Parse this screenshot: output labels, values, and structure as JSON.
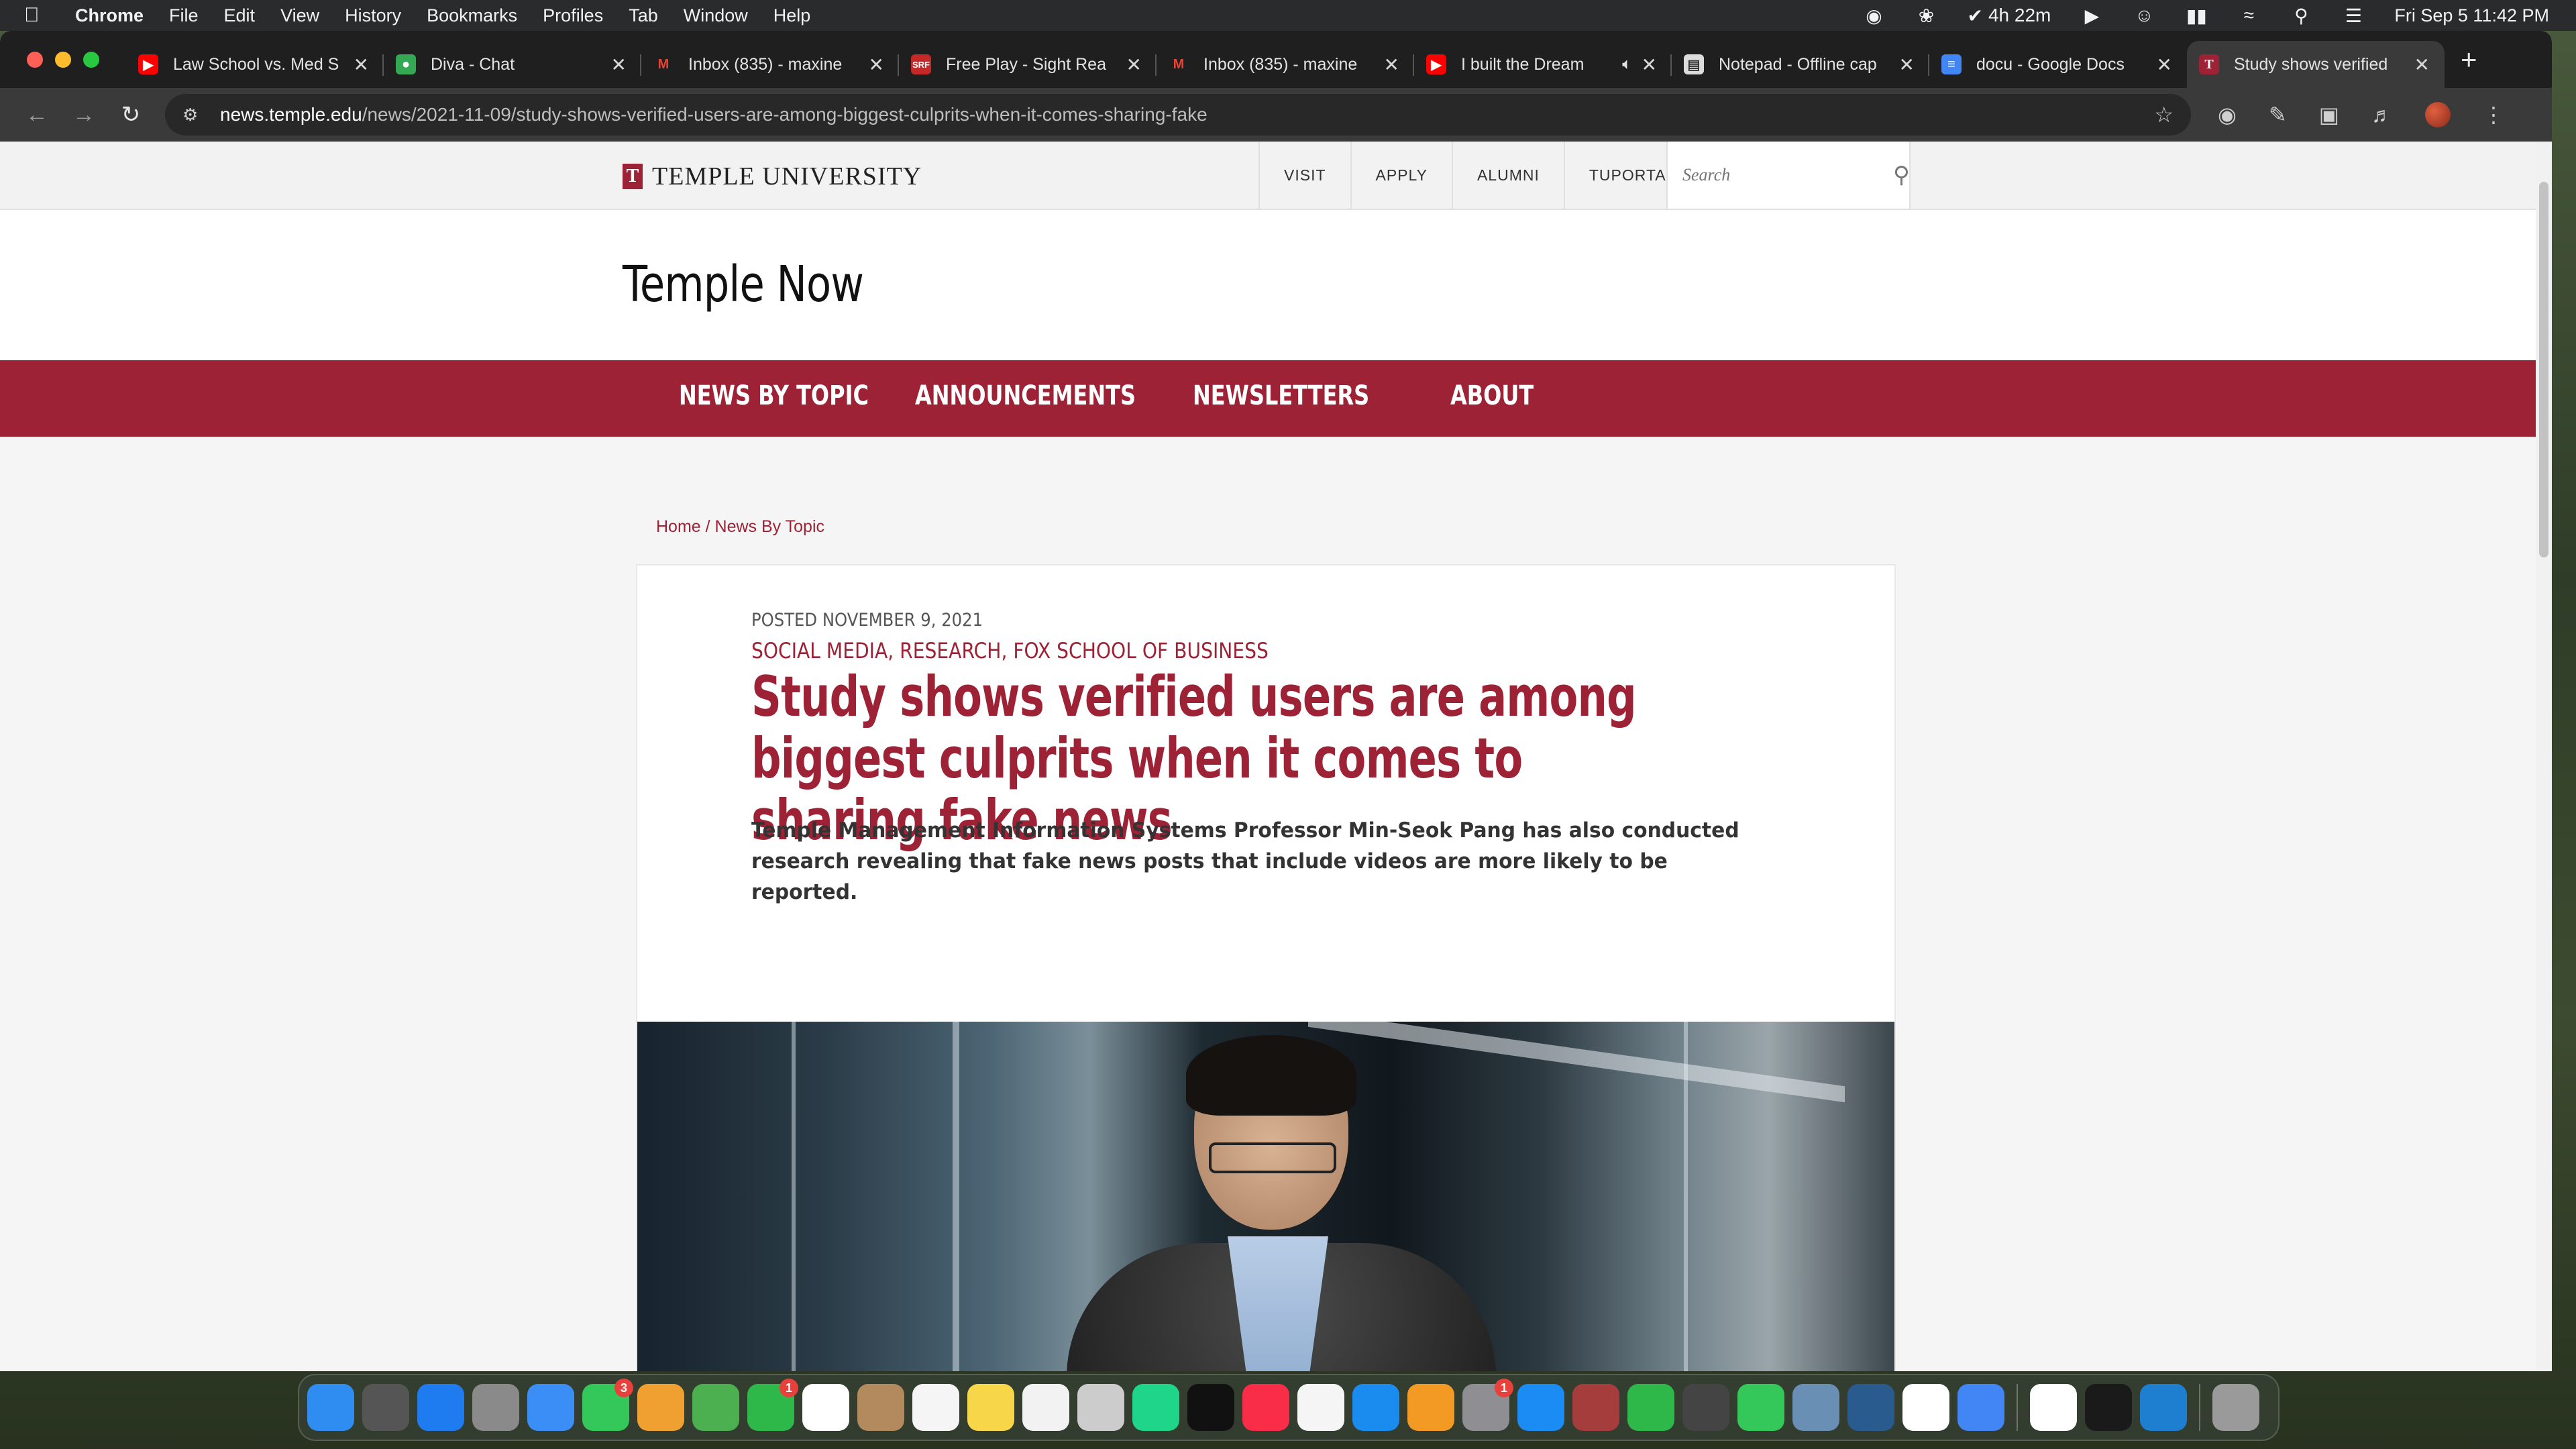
{
  "menubar": {
    "app": "Chrome",
    "items": [
      "File",
      "Edit",
      "View",
      "History",
      "Bookmarks",
      "Profiles",
      "Tab",
      "Window",
      "Help"
    ],
    "timer": "4h 22m",
    "datetime": "Fri Sep 5  11:42 PM"
  },
  "tabs": [
    {
      "title": "Law School vs. Med S",
      "icon": "youtube-icon",
      "color": "#ff0000"
    },
    {
      "title": "Diva - Chat",
      "icon": "google-chat-icon",
      "color": "#34a853"
    },
    {
      "title": "Inbox (835) - maxine",
      "icon": "gmail-icon",
      "color": "#ea4335"
    },
    {
      "title": "Free Play - Sight Rea",
      "icon": "sightreading-icon",
      "color": "#c62828"
    },
    {
      "title": "Inbox (835) - maxine",
      "icon": "gmail-icon",
      "color": "#ea4335"
    },
    {
      "title": "I built the Dream",
      "icon": "youtube-icon",
      "color": "#ff0000"
    },
    {
      "title": "Notepad - Offline cap",
      "icon": "notepad-icon",
      "color": "#dddddd"
    },
    {
      "title": "docu - Google Docs",
      "icon": "google-docs-icon",
      "color": "#4285f4"
    },
    {
      "title": "Study shows verified",
      "icon": "temple-icon",
      "color": "#9d2235"
    }
  ],
  "address": {
    "url_host": "news.temple.edu",
    "url_path": "/news/2021-11-09/study-shows-verified-users-are-among-biggest-culprits-when-it-comes-sharing-fake"
  },
  "site": {
    "university": "TEMPLE UNIVERSITY",
    "util_nav": [
      "VISIT",
      "APPLY",
      "ALUMNI",
      "TUPORTAL"
    ],
    "search_placeholder": "Search",
    "title": "Temple Now",
    "main_nav": [
      "NEWS BY TOPIC",
      "ANNOUNCEMENTS",
      "NEWSLETTERS",
      "ABOUT"
    ],
    "breadcrumb": {
      "home": "Home",
      "separator": " / ",
      "current": "News By Topic"
    },
    "accent_color": "#9d2235"
  },
  "article": {
    "posted": "POSTED NOVEMBER 9, 2021",
    "categories": [
      "SOCIAL MEDIA",
      "RESEARCH",
      "FOX SCHOOL OF BUSINESS"
    ],
    "headline": "Study shows verified users are among biggest culprits when it comes to sharing fake news",
    "dek": "Temple Management Information Systems Professor Min-Seok Pang has also conducted research revealing that fake news posts that include videos are more likely to be reported."
  },
  "dock": {
    "apps": [
      {
        "name": "finder-icon",
        "color": "#2f8cf0"
      },
      {
        "name": "launchpad-rocket-icon",
        "color": "#555555"
      },
      {
        "name": "safari-icon",
        "color": "#1e7bf0"
      },
      {
        "name": "launchpad-icon",
        "color": "#8a8a8a"
      },
      {
        "name": "mail-icon",
        "color": "#3a8ef5"
      },
      {
        "name": "messages-icon",
        "color": "#34c759",
        "badge": "3"
      },
      {
        "name": "photos-icon",
        "color": "#f0a030"
      },
      {
        "name": "maps-icon",
        "color": "#4caf50"
      },
      {
        "name": "facetime-icon",
        "color": "#2fb84a",
        "badge": "1"
      },
      {
        "name": "calendar-icon",
        "color": "#ffffff"
      },
      {
        "name": "contacts-icon",
        "color": "#b38a5e"
      },
      {
        "name": "reminders-icon",
        "color": "#f5f5f5"
      },
      {
        "name": "notes-icon",
        "color": "#f7d64a"
      },
      {
        "name": "freeform-icon",
        "color": "#f2f2f2"
      },
      {
        "name": "script-editor-icon",
        "color": "#cccccc"
      },
      {
        "name": "pycharm-icon",
        "color": "#1ed58a"
      },
      {
        "name": "apple-tv-icon",
        "color": "#111111"
      },
      {
        "name": "music-icon",
        "color": "#fa2d48"
      },
      {
        "name": "news-icon",
        "color": "#f5f5f5"
      },
      {
        "name": "keynote-icon",
        "color": "#1a8cf0"
      },
      {
        "name": "pages-icon",
        "color": "#f39a24"
      },
      {
        "name": "system-settings-icon",
        "color": "#8e8e93",
        "badge": "1"
      },
      {
        "name": "app-store-icon",
        "color": "#1c8cf5"
      },
      {
        "name": "dictionary-icon",
        "color": "#a63d3d"
      },
      {
        "name": "numbers-icon",
        "color": "#2fb84a"
      },
      {
        "name": "pencil-app-icon",
        "color": "#444444"
      },
      {
        "name": "find-my-icon",
        "color": "#34c759"
      },
      {
        "name": "preview-icon",
        "color": "#6a8fb5"
      },
      {
        "name": "quicktime-icon",
        "color": "#2a5b8f"
      },
      {
        "name": "clock-icon",
        "color": "#ffffff"
      },
      {
        "name": "chrome-icon",
        "color": "#4285f4"
      },
      {
        "name": "slack-icon",
        "color": "#ffffff"
      },
      {
        "name": "terminal-icon",
        "color": "#1a1a1a"
      },
      {
        "name": "vscode-icon",
        "color": "#1e7fd1"
      },
      {
        "name": "trash-icon",
        "color": "#9a9a9a"
      }
    ]
  }
}
